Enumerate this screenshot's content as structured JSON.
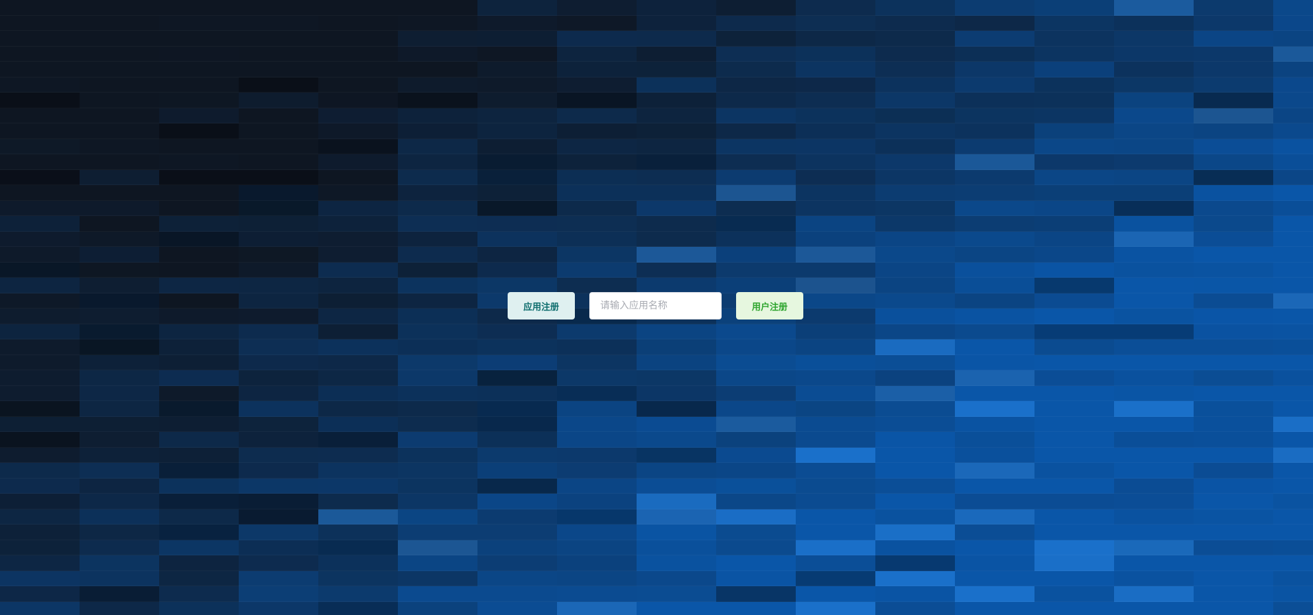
{
  "toolbar": {
    "app_register_label": "应用注册",
    "app_name_placeholder": "请输入应用名称",
    "app_name_value": "",
    "user_register_label": "用户注册"
  },
  "background": {
    "style": "blue mosaic tiles",
    "base_color": "#0e1622",
    "accent_color": "#0a56a8"
  }
}
